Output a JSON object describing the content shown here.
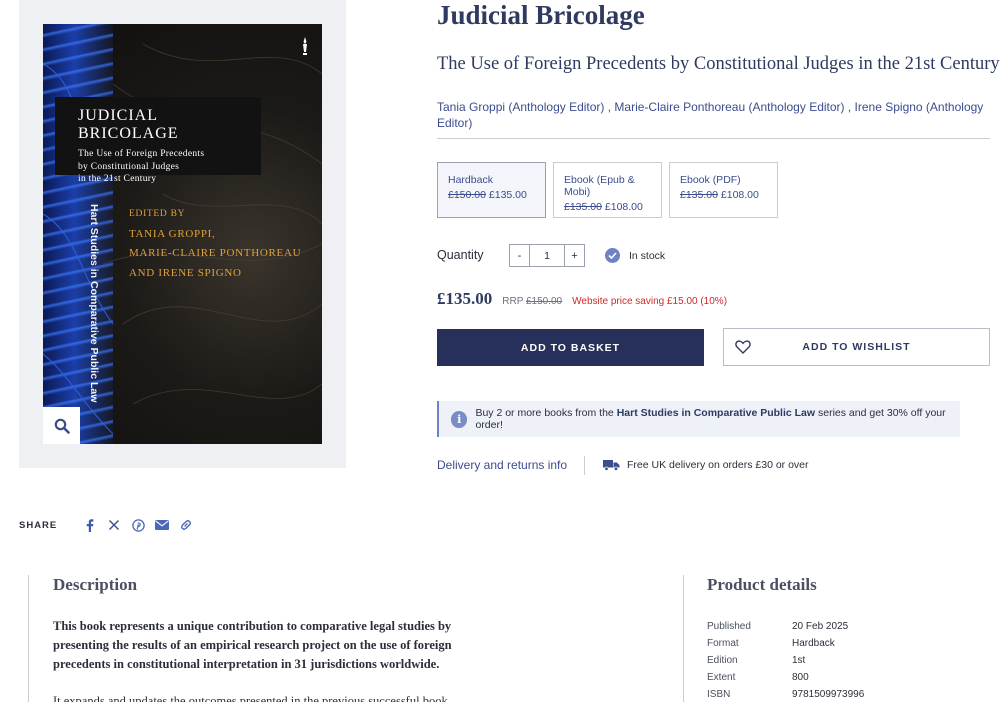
{
  "cover": {
    "title": "JUDICIAL BRICOLAGE",
    "subtitle_lines": [
      "The Use of Foreign Precedents",
      "by Constitutional Judges",
      "in the 21st Century"
    ],
    "edited_by": "EDITED BY",
    "editor_lines": [
      "TANIA GROPPI,",
      "MARIE-CLAIRE PONTHOREAU",
      "AND IRENE SPIGNO"
    ],
    "series_spine": "Hart Studies in Comparative Public Law"
  },
  "share": {
    "label": "SHARE",
    "icons": [
      "facebook-icon",
      "x-icon",
      "pinterest-icon",
      "email-icon",
      "link-icon"
    ]
  },
  "book": {
    "title": "Judicial Bricolage",
    "subtitle": "The Use of Foreign Precedents by Constitutional Judges in the 21st Century",
    "authors_line1": "Tania Groppi (Anthology Editor) , Marie-Claire Ponthoreau (Anthology Editor) , Irene Spigno (Anthology",
    "authors_line2": "Editor)"
  },
  "formats": [
    {
      "name": "Hardback",
      "old_price": "£150.00",
      "price": "£135.00",
      "selected": true
    },
    {
      "name": "Ebook (Epub & Mobi)",
      "old_price": "£135.00",
      "price": "£108.00",
      "selected": false
    },
    {
      "name": "Ebook (PDF)",
      "old_price": "£135.00",
      "price": "£108.00",
      "selected": false
    }
  ],
  "quantity": {
    "label": "Quantity",
    "minus": "-",
    "value": "1",
    "plus": "+",
    "stock": "In stock"
  },
  "pricing": {
    "price": "£135.00",
    "rrp_label": "RRP",
    "rrp_value": "£150.00",
    "saving": "Website price saving £15.00 (10%)"
  },
  "actions": {
    "basket": "ADD TO BASKET",
    "wishlist": "ADD TO WISHLIST"
  },
  "promo": {
    "pre": "Buy 2 or more books from the ",
    "series": "Hart Studies in Comparative Public Law",
    "post": " series and get 30% off your order!"
  },
  "delivery": {
    "link": "Delivery and returns info",
    "free": "Free UK delivery on orders £30 or over"
  },
  "description": {
    "heading": "Description",
    "lead_lines": [
      "This book represents a unique contribution to comparative legal studies by",
      "presenting the results of an empirical research project on the use of foreign",
      "precedents in constitutional interpretation in 31 jurisdictions worldwide."
    ],
    "next": "It expands and updates the outcomes presented in the previous successful book"
  },
  "product_details": {
    "heading": "Product details",
    "rows": [
      {
        "key": "Published",
        "value": "20 Feb 2025"
      },
      {
        "key": "Format",
        "value": "Hardback"
      },
      {
        "key": "Edition",
        "value": "1st"
      },
      {
        "key": "Extent",
        "value": "800"
      },
      {
        "key": "ISBN",
        "value": "9781509973996"
      }
    ]
  },
  "colors": {
    "navy": "#26305a",
    "link": "#3c4d8f",
    "sale_red": "#cf2a2a",
    "cover_gold": "#e0a23a",
    "panel_bg": "#eef0f4"
  }
}
